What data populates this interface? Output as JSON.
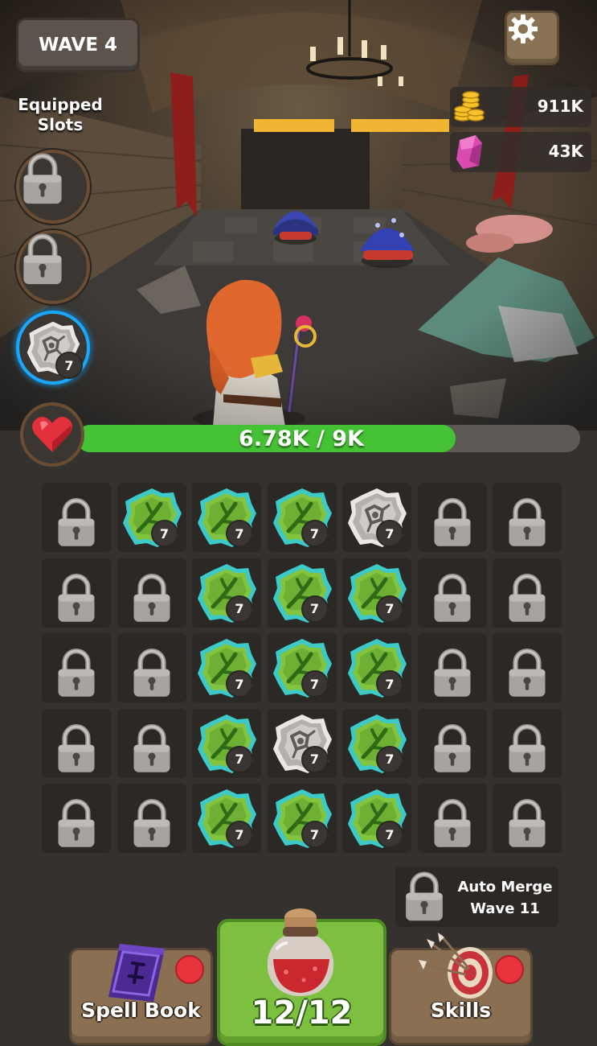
{
  "hud": {
    "wave_label": "WAVE 4",
    "equipped_title": "Equipped Slots",
    "settings_icon": "gear-icon"
  },
  "equipped_slots": [
    {
      "state": "locked",
      "icon": "lock-icon"
    },
    {
      "state": "locked",
      "icon": "lock-icon"
    },
    {
      "state": "equipped",
      "icon": "stone-rune-icon",
      "level": "7"
    }
  ],
  "currencies": {
    "gold": {
      "icon": "gold-coins-icon",
      "value": "911K"
    },
    "gems": {
      "icon": "pink-crystal-icon",
      "value": "43K"
    }
  },
  "health": {
    "icon": "heart-icon",
    "text": "6.78K / 9K",
    "fraction": 0.753
  },
  "grid": {
    "rows": [
      [
        {
          "t": "lock"
        },
        {
          "t": "leaf",
          "level": "7"
        },
        {
          "t": "leaf",
          "level": "7"
        },
        {
          "t": "leaf",
          "level": "7"
        },
        {
          "t": "stone",
          "level": "7"
        },
        {
          "t": "lock"
        },
        {
          "t": "lock"
        }
      ],
      [
        {
          "t": "lock"
        },
        {
          "t": "lock"
        },
        {
          "t": "leaf",
          "level": "7"
        },
        {
          "t": "leaf",
          "level": "7"
        },
        {
          "t": "leaf",
          "level": "7"
        },
        {
          "t": "lock"
        },
        {
          "t": "lock"
        }
      ],
      [
        {
          "t": "lock"
        },
        {
          "t": "lock"
        },
        {
          "t": "leaf",
          "level": "7"
        },
        {
          "t": "leaf",
          "level": "7"
        },
        {
          "t": "leaf",
          "level": "7"
        },
        {
          "t": "lock"
        },
        {
          "t": "lock"
        }
      ],
      [
        {
          "t": "lock"
        },
        {
          "t": "lock"
        },
        {
          "t": "leaf",
          "level": "7"
        },
        {
          "t": "stone",
          "level": "7"
        },
        {
          "t": "leaf",
          "level": "7"
        },
        {
          "t": "lock"
        },
        {
          "t": "lock"
        }
      ],
      [
        {
          "t": "lock"
        },
        {
          "t": "lock"
        },
        {
          "t": "leaf",
          "level": "7"
        },
        {
          "t": "leaf",
          "level": "7"
        },
        {
          "t": "leaf",
          "level": "7"
        },
        {
          "t": "lock"
        },
        {
          "t": "lock"
        }
      ]
    ]
  },
  "auto_merge": {
    "line1": "Auto Merge",
    "line2": "Wave 11",
    "icon": "lock-icon"
  },
  "bottom_bar": {
    "spell_book_label": "Spell Book",
    "spell_book_icon": "spell-book-icon",
    "potion_label": "12/12",
    "potion_icon": "potion-jar-icon",
    "skills_label": "Skills",
    "skills_icon": "target-arrows-icon"
  },
  "colors": {
    "health_green": "#44c134",
    "leaf_gem": "#7cc23a",
    "gem_glow": "#3ec9c9",
    "notification_red": "#e8323c",
    "equipped_ring": "#1aa8ff"
  }
}
